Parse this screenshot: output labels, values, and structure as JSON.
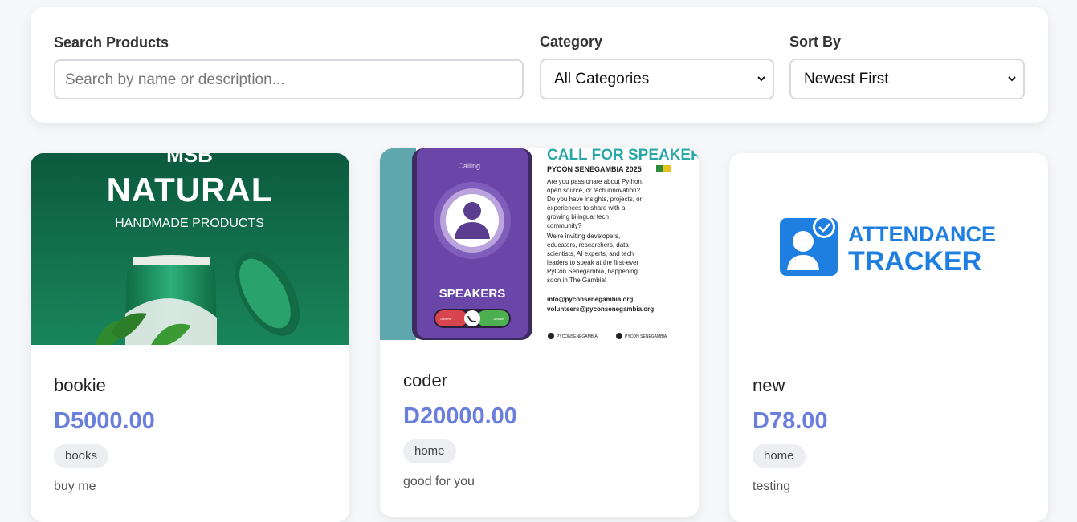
{
  "filters": {
    "search_label": "Search Products",
    "search_placeholder": "Search by name or description...",
    "category_label": "Category",
    "category_value": "All Categories",
    "sort_label": "Sort By",
    "sort_value": "Newest First"
  },
  "products": [
    {
      "name": "bookie",
      "price": "D5000.00",
      "category": "books",
      "description": "buy me",
      "image": {
        "brand_top": "MSB",
        "brand_main": "NATURAL",
        "brand_sub": "HANDMADE PRODUCTS",
        "colors": {
          "bg_top": "#0d5c40",
          "bg_bottom": "#1f8c5f",
          "jar": "#1f9a62"
        }
      }
    },
    {
      "name": "coder",
      "price": "D20000.00",
      "category": "home",
      "description": "good for you",
      "image": {
        "calling": "Calling...",
        "phone_label": "SPEAKERS",
        "decline": "Decline",
        "answer": "Answer",
        "headline": "CALL FOR SPEAKERS",
        "subhead": "PYCON SENEGAMBIA 2025",
        "paragraph1": [
          "Are you passionate about Python,",
          "open source, or tech innovation?",
          "Do you have insights, projects, or",
          "experiences to share with a",
          "growing bilingual tech",
          "community?"
        ],
        "paragraph2": [
          "We're inviting developers,",
          "educators, researchers, data",
          "scientists, AI experts, and tech",
          "leaders to speak at the first-ever",
          "PyCon Senegambia, happening",
          "soon in The Gambia!"
        ],
        "email1": "info@pyconsenegambia.org",
        "email2": "volunteers@pyconsenegambia.org",
        "social1": "PYCONSENEGAMBIA",
        "social2": "PYCON SENEGAMBIA",
        "colors": {
          "phone": "#6a46a8",
          "headline": "#2aa8a8",
          "side": "#5fa7ad"
        }
      }
    },
    {
      "name": "new",
      "price": "D78.00",
      "category": "home",
      "description": "testing",
      "image": {
        "line1": "ATTENDANCE",
        "line2": "TRACKER",
        "colors": {
          "brand": "#1e7fe0"
        }
      }
    }
  ]
}
